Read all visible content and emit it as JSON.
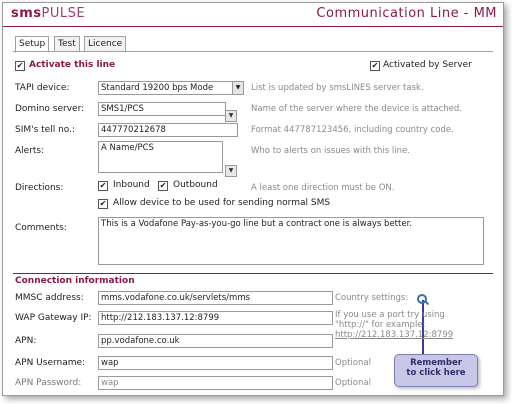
{
  "header": {
    "logo_bold": "sms",
    "logo_light": "PULSE",
    "title": "Communication Line - MM"
  },
  "tabs": [
    "Setup",
    "Test",
    "Licence"
  ],
  "activate": {
    "label": "Activate this line",
    "checked": true
  },
  "activated_by_server": {
    "label": "Activated by Server",
    "checked": true
  },
  "fields": {
    "tapi": {
      "label": "TAPI device:",
      "value": "Standard 19200 bps Mode",
      "help": "List is updated by smsLINES server task."
    },
    "domino": {
      "label": "Domino server:",
      "value": "SMS1/PCS",
      "help": "Name of the server where the device is attached."
    },
    "sim": {
      "label": "SIM's tell no.:",
      "value": "447770212678",
      "help": "Format 447787123456, including country code."
    },
    "alerts": {
      "label": "Alerts:",
      "value": "A Name/PCS",
      "help": "Who to alerts on issues with this line."
    },
    "directions": {
      "label": "Directions:",
      "inbound": "Inbound",
      "outbound": "Outbound",
      "help": "A least one direction must be ON.",
      "allow_normal": "Allow device to be used for sending normal SMS"
    },
    "comments": {
      "label": "Comments:",
      "value": "This is a Vodafone Pay-as-you-go line but a contract one is always better."
    }
  },
  "connection": {
    "title": "Connection information",
    "mmsc": {
      "label": "MMSC address:",
      "value": "mms.vodafone.co.uk/servlets/mms",
      "help": "Country settings:"
    },
    "wap": {
      "label": "WAP Gateway IP:",
      "value": "http://212.183.137.12:8799",
      "help1": "If you use a port try using",
      "help2": "\"http://\" for example:",
      "help3": "http://212.183.137.12:8799"
    },
    "apn": {
      "label": "APN:",
      "value": "pp.vodafone.co.uk"
    },
    "apn_user": {
      "label": "APN Username:",
      "value": "wap",
      "help": "Optional"
    },
    "apn_pass": {
      "label": "APN Password:",
      "value": "wap",
      "help": "Optional"
    }
  },
  "callout": {
    "line1": "Remember",
    "line2": "to click here"
  },
  "icons": {
    "search": "search-icon"
  }
}
